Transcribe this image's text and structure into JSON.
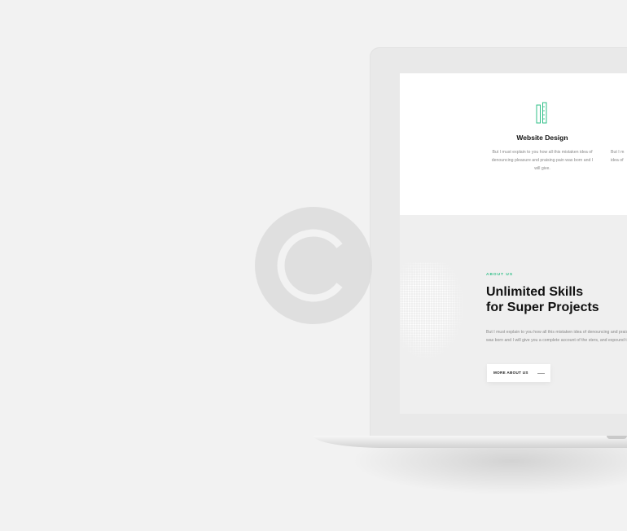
{
  "service": {
    "title": "Website Design",
    "text": "But I must explain to you how all this mistaken idea of denouncing pleasure and praising pain was born and I will give.",
    "next_text": "But I m\nidea of"
  },
  "about": {
    "eyebrow": "ABOUT US",
    "heading_line1": "Unlimited Skills",
    "heading_line2": "for Super Projects",
    "text": "But I must explain to you how all this mistaken idea of denouncing and praising pain was born and I will give you a complete account of the sters, and expound the actual.",
    "button_label": "MORE ABOUT US"
  },
  "icons": {
    "service": "pencil-ruler-icon",
    "watermark": "copyright-icon",
    "button_arrow": "line-arrow-icon"
  },
  "colors": {
    "accent": "#2fbf87",
    "page_bg": "#f2f2f2",
    "heading": "#111111"
  }
}
